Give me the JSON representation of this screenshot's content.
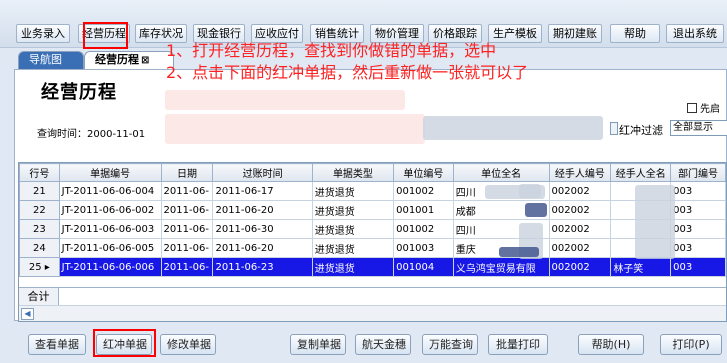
{
  "menu": [
    {
      "label": "业务录入",
      "left": 0
    },
    {
      "label": "经营历程"
    },
    {
      "label": "库存状况"
    },
    {
      "label": "现金银行"
    },
    {
      "label": "应收应付"
    },
    {
      "label": "销售统计"
    },
    {
      "label": "物价管理"
    },
    {
      "label": "价格跟踪"
    },
    {
      "label": "生产模板"
    },
    {
      "label": "期初建账"
    },
    {
      "label": "帮助"
    },
    {
      "label": "退出系统"
    }
  ],
  "tabs": {
    "nav": "导航图",
    "current": "经营历程",
    "close_glyph": "⊠"
  },
  "page": {
    "title": "经营历程",
    "query_time_label": "查询时间：2000-11-01",
    "filter_label": "红冲过滤",
    "filter_value": "全部显示",
    "checkbox_label": "先启"
  },
  "annotations": {
    "line1": "1、打开经营历程，查找到你做错的单据，选中",
    "line2": "2、点击下面的红冲单据，然后重新做一张就可以了"
  },
  "table": {
    "headers": [
      "行号",
      "单据编号",
      "日期",
      "过账时间",
      "单据类型",
      "单位编号",
      "单位全名",
      "经手人编号",
      "经手人全名",
      "部门编号"
    ],
    "rows": [
      {
        "num": "21",
        "arrow": "",
        "cells": [
          "JT-2011-06-06-004",
          "2011-06-",
          "2011-06-17",
          "进货退货",
          "001002",
          "四川",
          "002002",
          "",
          "003"
        ]
      },
      {
        "num": "22",
        "arrow": "",
        "cells": [
          "JT-2011-06-06-002",
          "2011-06-",
          "2011-06-20",
          "进货退货",
          "001001",
          "成都",
          "002002",
          "",
          "003"
        ]
      },
      {
        "num": "23",
        "arrow": "",
        "cells": [
          "JT-2011-06-06-003",
          "2011-06-",
          "2011-06-30",
          "进货退货",
          "001002",
          "四川",
          "002002",
          "",
          "003"
        ]
      },
      {
        "num": "24",
        "arrow": "",
        "cells": [
          "JT-2011-06-06-005",
          "2011-06-",
          "2011-06-20",
          "进货退货",
          "001003",
          "重庆",
          "002002",
          "",
          "003"
        ]
      },
      {
        "num": "25",
        "arrow": "▸",
        "selected": true,
        "cells": [
          "JT-2011-06-06-006",
          "2011-06-",
          "2011-06-23",
          "进货退货",
          "001004",
          "义乌鸿宝贸易有限",
          "002002",
          "林子笑",
          "003"
        ]
      }
    ],
    "total_label": "合计"
  },
  "buttons": {
    "view": "查看单据",
    "red_reverse": "红冲单据",
    "modify": "修改单据",
    "copy": "复制单据",
    "hangtian": "航天金穗",
    "query": "万能查询",
    "batch_print": "批量打印",
    "help": "帮助(H)",
    "print": "打印(P)"
  },
  "colors": {
    "highlight": "#ff0000",
    "selected_row": "#1818e6",
    "annotation_text": "#ff2222"
  }
}
